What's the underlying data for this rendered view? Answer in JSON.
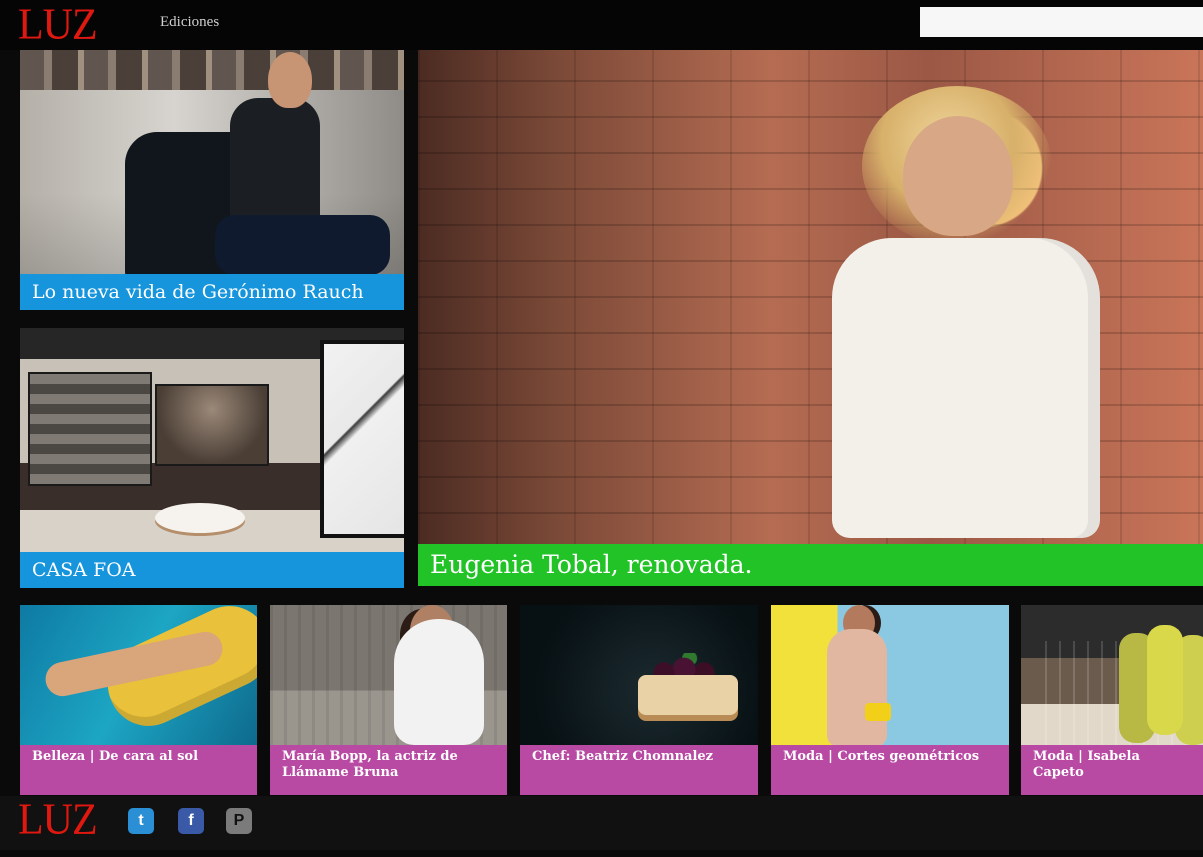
{
  "header": {
    "logo": "LUZ",
    "nav_label": "Ediciones",
    "search_placeholder": ""
  },
  "feature": {
    "left_top_caption": "Lo nueva vida de Gerónimo Rauch",
    "left_bottom_caption": "CASA FOA",
    "main_caption": "Eugenia Tobal, renovada."
  },
  "cards": [
    {
      "caption": "Belleza | De cara al sol"
    },
    {
      "caption": "María Bopp, la actriz de Llámame Bruna"
    },
    {
      "caption": "Chef: Beatriz Chomnalez"
    },
    {
      "caption": "Moda | Cortes geométricos"
    },
    {
      "caption": "Moda | Isabela Capeto"
    }
  ],
  "footer": {
    "logo": "LUZ",
    "social_icons": [
      "twitter-icon",
      "facebook-icon",
      "pinterest-icon"
    ]
  },
  "colors": {
    "brand_red": "#e1180f",
    "caption_blue": "#1795dc",
    "caption_green": "#22c327",
    "caption_pink": "#b84aa3"
  }
}
